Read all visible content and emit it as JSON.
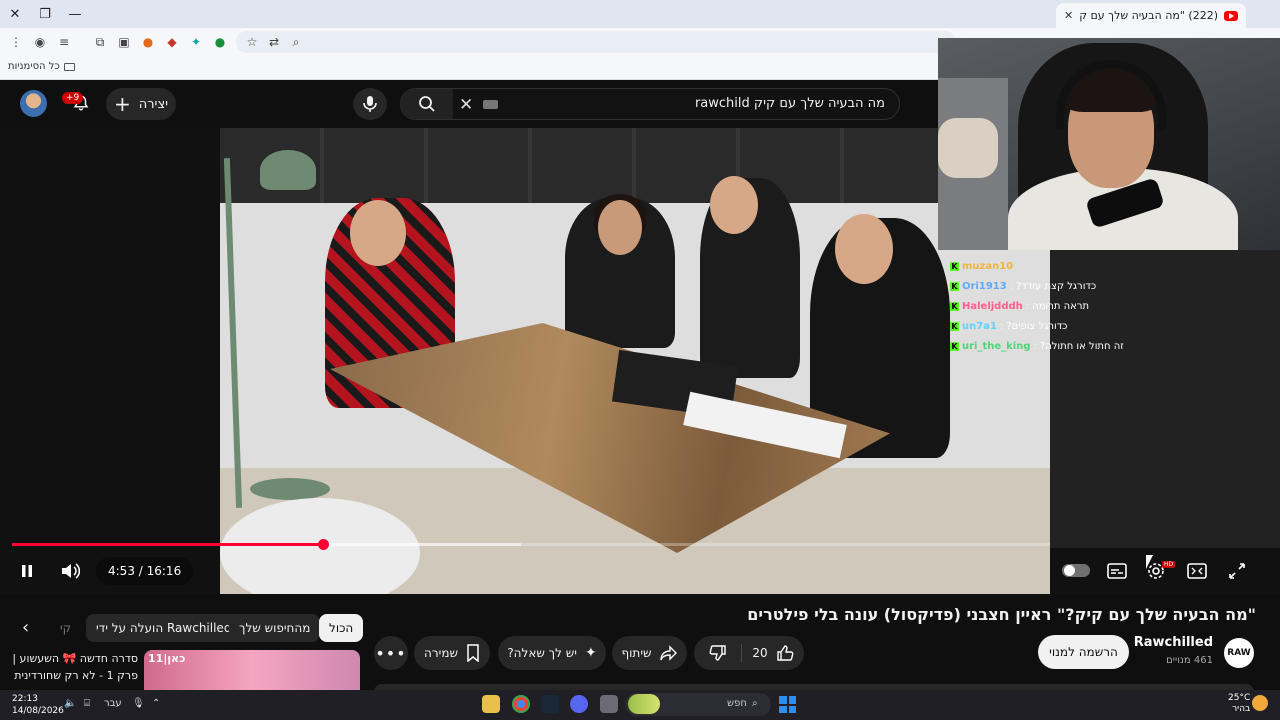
{
  "browser": {
    "tab_title": "(222) \"מה הבעיה שלך עם ק",
    "bookmarks_label": "כל הסימניות"
  },
  "youtube": {
    "notifications_badge": "+9",
    "create_label": "יצירה",
    "search_query": "מה הבעיה שלך עם קיק rawchild"
  },
  "overlay_chat": [
    {
      "user": "muzan10",
      "msg": "",
      "color": "#f0b43c"
    },
    {
      "user": "Ori1913",
      "msg": "כדורגל קצת עודד?",
      "color": "#5fa8ff"
    },
    {
      "user": "Haleljdddh",
      "msg": "תראה תרומה",
      "color": "#ff5d8f"
    },
    {
      "user": "un7a1",
      "msg": "כדורגל צופים?",
      "color": "#5fd0ff"
    },
    {
      "user": "uri_the_king",
      "msg": "זה חתול או חתולה?",
      "color": "#4fd67a"
    }
  ],
  "player": {
    "time_display": "4:53 / 16:16",
    "progress_fraction": 0.3,
    "buffered_fraction": 0.49,
    "hd_badge": "HD"
  },
  "video": {
    "title": "\"מה הבעיה שלך עם קיק?\" ראיין חצבני (פדיקסול) עונה בלי פילטרים",
    "channel_name": "Rawchilled",
    "channel_logo_text": "RAW",
    "subscribers": "461 מנויים",
    "subscribe_label": "הרשמה למנוי",
    "like_count": "20",
    "share_label": "שיתוף",
    "ask_label": "יש לך שאלה?",
    "save_label": "שמירה"
  },
  "chips": {
    "all": "הכול",
    "from_search": "מהחיפוש שלך",
    "uploaded_by": "הועלה על ידי Rawchilled",
    "partial": "קי"
  },
  "recommendation": {
    "title": "סדרה חדשה 🎀 השעשוע | פרק 1 - לא רק שחורדינית",
    "thumb_logo": "כאן|11"
  },
  "taskbar": {
    "time": "22:13",
    "date": "14/08/2026",
    "search_placeholder": "חפש",
    "language": "עבר",
    "weather_temp": "25°C",
    "weather_desc": "בהיר"
  }
}
